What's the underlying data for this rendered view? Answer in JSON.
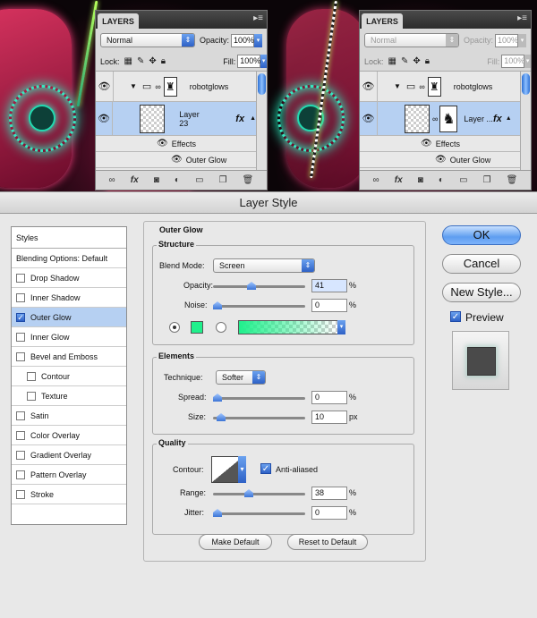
{
  "layers_left": {
    "tab": "LAYERS",
    "blend_mode": "Normal",
    "opacity_label": "Opacity:",
    "opacity": "100%",
    "lock_label": "Lock:",
    "fill_label": "Fill:",
    "fill": "100%",
    "group_name": "robotglows",
    "layer_name": "Layer 23",
    "fx": "fx",
    "effects_label": "Effects",
    "effect_item": "Outer Glow"
  },
  "layers_right": {
    "tab": "LAYERS",
    "blend_mode": "Normal",
    "opacity_label": "Opacity:",
    "opacity": "100%",
    "lock_label": "Lock:",
    "fill_label": "Fill:",
    "fill": "100%",
    "group_name": "robotglows",
    "layer_name": "Layer ...",
    "fx": "fx",
    "effects_label": "Effects",
    "effect_item": "Outer Glow"
  },
  "dialog": {
    "title": "Layer Style",
    "styles_header": "Styles",
    "styles": [
      {
        "label": "Blending Options: Default",
        "checkbox": false,
        "checked": false,
        "indent": false,
        "selected": false
      },
      {
        "label": "Drop Shadow",
        "checkbox": true,
        "checked": false,
        "indent": false,
        "selected": false
      },
      {
        "label": "Inner Shadow",
        "checkbox": true,
        "checked": false,
        "indent": false,
        "selected": false
      },
      {
        "label": "Outer Glow",
        "checkbox": true,
        "checked": true,
        "indent": false,
        "selected": true
      },
      {
        "label": "Inner Glow",
        "checkbox": true,
        "checked": false,
        "indent": false,
        "selected": false
      },
      {
        "label": "Bevel and Emboss",
        "checkbox": true,
        "checked": false,
        "indent": false,
        "selected": false
      },
      {
        "label": "Contour",
        "checkbox": true,
        "checked": false,
        "indent": true,
        "selected": false
      },
      {
        "label": "Texture",
        "checkbox": true,
        "checked": false,
        "indent": true,
        "selected": false
      },
      {
        "label": "Satin",
        "checkbox": true,
        "checked": false,
        "indent": false,
        "selected": false
      },
      {
        "label": "Color Overlay",
        "checkbox": true,
        "checked": false,
        "indent": false,
        "selected": false
      },
      {
        "label": "Gradient Overlay",
        "checkbox": true,
        "checked": false,
        "indent": false,
        "selected": false
      },
      {
        "label": "Pattern Overlay",
        "checkbox": true,
        "checked": false,
        "indent": false,
        "selected": false
      },
      {
        "label": "Stroke",
        "checkbox": true,
        "checked": false,
        "indent": false,
        "selected": false
      }
    ],
    "section_title": "Outer Glow",
    "structure": {
      "title": "Structure",
      "blend_mode_label": "Blend Mode:",
      "blend_mode": "Screen",
      "opacity_label": "Opacity:",
      "opacity": "41",
      "opacity_level": 0.41,
      "noise_label": "Noise:",
      "noise": "0",
      "noise_level": 0.0,
      "percent": "%",
      "glow_color": "#20f08c"
    },
    "elements": {
      "title": "Elements",
      "technique_label": "Technique:",
      "technique": "Softer",
      "spread_label": "Spread:",
      "spread": "0",
      "spread_level": 0.0,
      "size_label": "Size:",
      "size": "10",
      "size_level": 0.04,
      "percent": "%",
      "px": "px"
    },
    "quality": {
      "title": "Quality",
      "contour_label": "Contour:",
      "anti_aliased_label": "Anti-aliased",
      "anti_aliased": true,
      "range_label": "Range:",
      "range": "38",
      "range_level": 0.38,
      "jitter_label": "Jitter:",
      "jitter": "0",
      "jitter_level": 0.0,
      "percent": "%"
    },
    "make_default": "Make Default",
    "reset_default": "Reset to Default",
    "ok": "OK",
    "cancel": "Cancel",
    "new_style": "New Style...",
    "preview_label": "Preview",
    "preview_checked": true
  },
  "colors": {
    "selection": "#b6d0f2",
    "accent_blue": "#2e61c6",
    "glow_green": "#20f08c"
  }
}
